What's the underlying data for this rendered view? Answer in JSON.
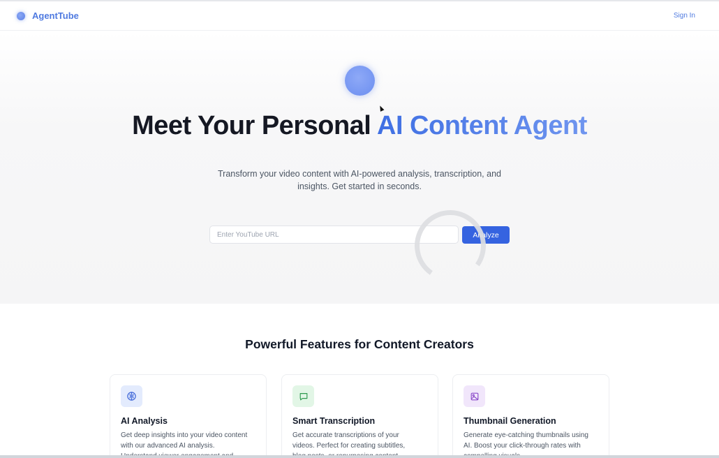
{
  "brand": {
    "name": "AgentTube",
    "accent_color": "#4f7ae0"
  },
  "header": {
    "signin_label": "Sign In"
  },
  "hero": {
    "title_prefix": "Meet Your Personal ",
    "title_accent": "AI Content Agent",
    "subtitle_line1": "Transform your video content with AI-powered analysis, transcription, and",
    "subtitle_line2": "insights. Get started in seconds.",
    "url_placeholder": "Enter YouTube URL",
    "url_value": "",
    "analyze_label": "Analyze",
    "analyze_color": "#3563e0"
  },
  "features": {
    "title": "Powerful Features for Content Creators",
    "cards": [
      {
        "icon": "brain-icon",
        "icon_bg": "#e3ebfd",
        "icon_color": "#3f67d8",
        "title": "AI Analysis",
        "desc_lines": [
          "Get deep insights into your video content",
          "with our advanced AI analysis.",
          "Understand viewer engagement and"
        ]
      },
      {
        "icon": "message-icon",
        "icon_bg": "#e2f6e6",
        "icon_color": "#2e9a4f",
        "title": "Smart Transcription",
        "desc_lines": [
          "Get accurate transcriptions of your",
          "videos. Perfect for creating subtitles,",
          "blog posts, or repurposing content."
        ]
      },
      {
        "icon": "image-icon",
        "icon_bg": "#f1e6fb",
        "icon_color": "#8a49c9",
        "title": "Thumbnail Generation",
        "desc_lines": [
          "Generate eye-catching thumbnails using",
          "AI. Boost your click-through rates with",
          "compelling visuals."
        ]
      }
    ]
  }
}
